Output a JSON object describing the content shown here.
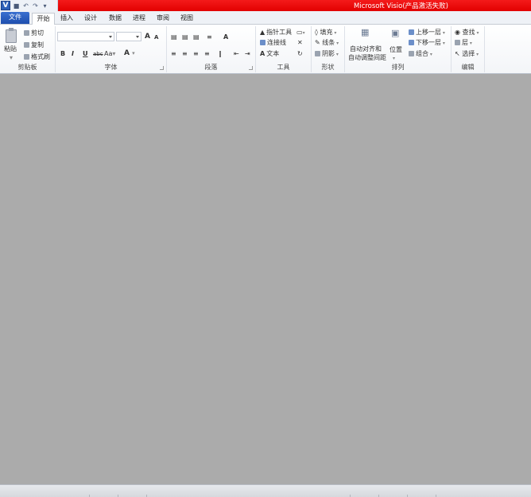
{
  "window": {
    "title": "Microsoft Visio(产品激活失败)",
    "app_icon_label": "V",
    "qat": {
      "save_icon": "save-icon",
      "undo_icon": "undo-icon",
      "redo_icon": "redo-icon",
      "customize_icon": "customize-icon"
    }
  },
  "tabs": [
    {
      "label": "文件"
    },
    {
      "label": "开始"
    },
    {
      "label": "插入"
    },
    {
      "label": "设计"
    },
    {
      "label": "数据"
    },
    {
      "label": "进程"
    },
    {
      "label": "审阅"
    },
    {
      "label": "视图"
    }
  ],
  "ribbon": {
    "clipboard": {
      "label": "剪贴板",
      "paste": "粘贴",
      "cut": "剪切",
      "copy": "复制",
      "format_painter": "格式刷"
    },
    "font": {
      "label": "字体",
      "font_name": "",
      "font_size": "",
      "grow": "A",
      "shrink": "A",
      "bold": "B",
      "italic": "I",
      "underline": "U",
      "strike": "abc",
      "case": "Aa",
      "color": "A"
    },
    "paragraph": {
      "label": "段落"
    },
    "tools": {
      "label": "工具",
      "pointer": "指针工具",
      "connector": "连接线",
      "text": "文本"
    },
    "shape": {
      "label": "形状",
      "fill": "填充",
      "line": "线条",
      "shadow": "阴影"
    },
    "arrange": {
      "label": "排列",
      "auto_align_1": "自动对齐和",
      "auto_align_2": "自动调整间距",
      "position": "位置",
      "bring_forward": "上移一层",
      "send_backward": "下移一层",
      "group": "组合"
    },
    "editing": {
      "label": "编辑",
      "find": "查找",
      "layers": "层",
      "select": "选择"
    }
  }
}
